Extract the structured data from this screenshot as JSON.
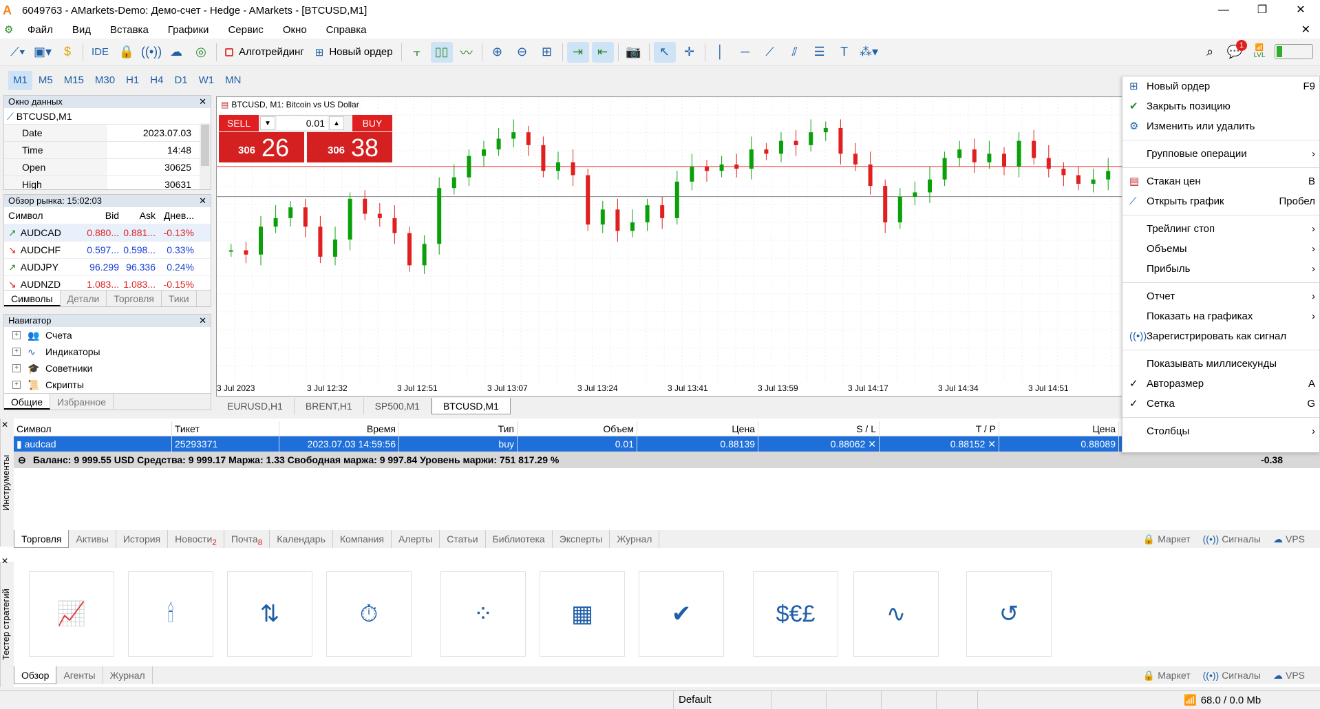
{
  "window": {
    "title": "6049763 - AMarkets-Demo: Демо-счет - Hedge - AMarkets - [BTCUSD,M1]",
    "logo": "A"
  },
  "menu": [
    "Файл",
    "Вид",
    "Вставка",
    "Графики",
    "Сервис",
    "Окно",
    "Справка"
  ],
  "toolbar": {
    "ide": "IDE",
    "algo": "Алготрейдинг",
    "new_order": "Новый ордер",
    "notif_count": "1",
    "lvl": "LVL"
  },
  "timeframes": [
    "M1",
    "M5",
    "M15",
    "M30",
    "H1",
    "H4",
    "D1",
    "W1",
    "MN"
  ],
  "data_window": {
    "title": "Окно данных",
    "symbol": "BTCUSD,M1",
    "rows": [
      [
        "Date",
        "2023.07.03"
      ],
      [
        "Time",
        "14:48"
      ],
      [
        "Open",
        "30625"
      ],
      [
        "High",
        "30631"
      ]
    ]
  },
  "market_watch": {
    "title": "Обзор рынка: 15:02:03",
    "headers": [
      "Символ",
      "Bid",
      "Ask",
      "Днев..."
    ],
    "rows": [
      {
        "sym": "AUDCAD",
        "bid": "0.880...",
        "ask": "0.881...",
        "chg": "-0.13%",
        "dir": "up",
        "col": "#e02020"
      },
      {
        "sym": "AUDCHF",
        "bid": "0.597...",
        "ask": "0.598...",
        "chg": "0.33%",
        "dir": "down",
        "col": "#1a3fd6"
      },
      {
        "sym": "AUDJPY",
        "bid": "96.299",
        "ask": "96.336",
        "chg": "0.24%",
        "dir": "up",
        "col": "#1a3fd6"
      },
      {
        "sym": "AUDNZD",
        "bid": "1.083...",
        "ask": "1.083...",
        "chg": "-0.15%",
        "dir": "down",
        "col": "#e02020"
      }
    ],
    "tabs": [
      "Символы",
      "Детали",
      "Торговля",
      "Тики"
    ]
  },
  "navigator": {
    "title": "Навигатор",
    "items": [
      "Счета",
      "Индикаторы",
      "Советники",
      "Скрипты"
    ],
    "tabs": [
      "Общие",
      "Избранное"
    ]
  },
  "chart": {
    "label": "BTCUSD, M1:  Bitcoin vs US Dollar",
    "sell": "SELL",
    "buy": "BUY",
    "volume": "0.01",
    "bid_big": "306",
    "bid_small": "26",
    "ask_big": "306",
    "ask_small": "38",
    "time_labels": [
      "3 Jul 2023",
      "3 Jul 12:32",
      "3 Jul 12:51",
      "3 Jul 13:07",
      "3 Jul 13:24",
      "3 Jul 13:41",
      "3 Jul 13:59",
      "3 Jul 14:17",
      "3 Jul 14:34",
      "3 Jul 14:51"
    ],
    "tabs": [
      "EURUSD,H1",
      "BRENT,H1",
      "SP500,M1",
      "BTCUSD,M1"
    ]
  },
  "chart_data": {
    "type": "candlestick",
    "title": "BTCUSD, M1:  Bitcoin vs US Dollar",
    "xlabel": "",
    "ylabel": "",
    "x": [
      "3 Jul 2023",
      "3 Jul 12:32",
      "3 Jul 12:51",
      "3 Jul 13:07",
      "3 Jul 13:24",
      "3 Jul 13:41",
      "3 Jul 13:59",
      "3 Jul 14:17",
      "3 Jul 14:34",
      "3 Jul 14:51"
    ],
    "series": [
      {
        "values": [
          55,
          53,
          66,
          70,
          75,
          66,
          52,
          60,
          79,
          72,
          70,
          63,
          48,
          58,
          84,
          89,
          99,
          102,
          107,
          110,
          104,
          92,
          96,
          90,
          67,
          74,
          64,
          68,
          76,
          70,
          87,
          94,
          92,
          95,
          93,
          102,
          100,
          106,
          104,
          110,
          112,
          100,
          95,
          85,
          68,
          80,
          82,
          88,
          98,
          102,
          96,
          100,
          94,
          106,
          98,
          93,
          90,
          86,
          88,
          92
        ]
      }
    ],
    "bid_line": "red",
    "ask_line": "gray",
    "grid": true
  },
  "context_menu": {
    "items": [
      {
        "label": "Новый ордер",
        "sc": "F9",
        "icon": "plus"
      },
      {
        "label": "Закрыть позицию",
        "sc": "",
        "icon": "check"
      },
      {
        "label": "Изменить или удалить",
        "sc": "",
        "icon": "gear"
      },
      {
        "sep": true
      },
      {
        "label": "Групповые операции",
        "sc": "›",
        "icon": ""
      },
      {
        "sep": true
      },
      {
        "label": "Стакан цен",
        "sc": "B",
        "icon": "book"
      },
      {
        "label": "Открыть график",
        "sc": "Пробел",
        "icon": "chart"
      },
      {
        "sep": true
      },
      {
        "label": "Трейлинг стоп",
        "sc": "›",
        "icon": ""
      },
      {
        "label": "Объемы",
        "sc": "›",
        "icon": ""
      },
      {
        "label": "Прибыль",
        "sc": "›",
        "icon": ""
      },
      {
        "sep": true
      },
      {
        "label": "Отчет",
        "sc": "›",
        "icon": ""
      },
      {
        "label": "Показать на графиках",
        "sc": "›",
        "icon": ""
      },
      {
        "label": "Зарегистрировать как сигнал",
        "sc": "",
        "icon": "signal"
      },
      {
        "sep": true
      },
      {
        "label": "Показывать миллисекунды",
        "sc": "",
        "icon": ""
      },
      {
        "label": "Авторазмер",
        "sc": "A",
        "icon": "tick"
      },
      {
        "label": "Сетка",
        "sc": "G",
        "icon": "tick"
      },
      {
        "sep": true
      },
      {
        "label": "Столбцы",
        "sc": "›",
        "icon": ""
      }
    ]
  },
  "toolbox": {
    "side_label": "Инструменты",
    "headers": [
      "Символ",
      "Тикет",
      "Время",
      "Тип",
      "Объем",
      "Цена",
      "S / L",
      "T / P",
      "Цена"
    ],
    "row": [
      "audcad",
      "25293371",
      "2023.07.03 14:59:56",
      "buy",
      "0.01",
      "0.88139",
      "0.88062",
      "0.88152",
      "0.88089"
    ],
    "balance": "Баланс: 9 999.55 USD  Средства: 9 999.17  Маржа: 1.33  Свободная маржа: 9 997.84  Уровень маржи: 751 817.29 %",
    "profit": "-0.38",
    "tabs": [
      "Торговля",
      "Активы",
      "История",
      "Новости",
      "Почта",
      "Календарь",
      "Компания",
      "Алерты",
      "Статьи",
      "Библиотека",
      "Эксперты",
      "Журнал"
    ],
    "news_badge": "2",
    "mail_badge": "8",
    "links": [
      "Маркет",
      "Сигналы",
      "VPS"
    ]
  },
  "tester": {
    "side_label": "Тестер стратегий",
    "tabs": [
      "Обзор",
      "Агенты",
      "Журнал"
    ],
    "links": [
      "Маркет",
      "Сигналы",
      "VPS"
    ]
  },
  "status": {
    "profile": "Default",
    "net": "68.0 / 0.0 Mb"
  }
}
